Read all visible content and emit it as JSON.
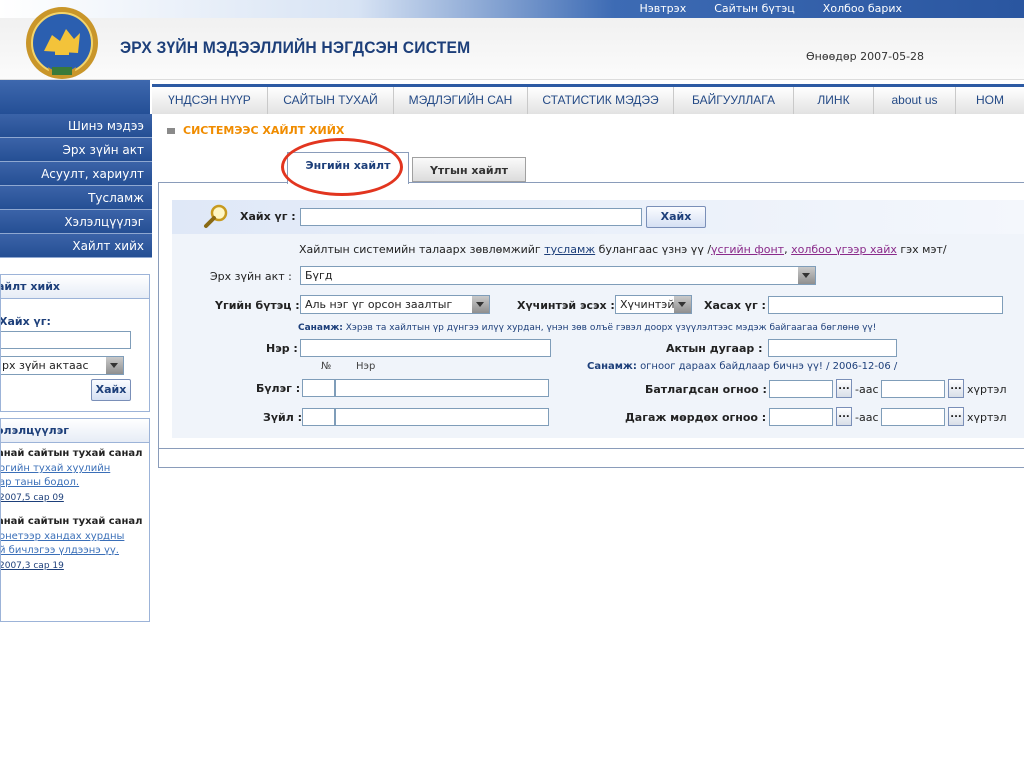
{
  "top_links": [
    "Нэвтрэх",
    "Сайтын бүтэц",
    "Холбоо барих"
  ],
  "site": {
    "title": "ЭРХ ЗҮЙН МЭДЭЭЛЛИЙН НЭГДСЭН СИСТЕМ",
    "today_label": "Өнөөдөр 2007-05-28"
  },
  "main_nav": [
    "ҮНДСЭН НҮҮР",
    "САЙТЫН ТУХАЙ",
    "МЭДЛЭГИЙН САН",
    "СТАТИСТИК МЭДЭЭ",
    "БАЙГУУЛЛАГА",
    "ЛИНК",
    "about us",
    "НОМ"
  ],
  "sidebar": {
    "menu": [
      "Шинэ мэдээ",
      "Эрх зүйн акт",
      "Асуулт, хариулт",
      "Тусламж",
      "Хэлэлцүүлэг",
      "Хайлт хийх"
    ],
    "search_box": {
      "title": "айлт хийх",
      "keyword_label": "Хайх үг:",
      "keyword_value": "",
      "scope_value": "рх зүйн актаас",
      "button": "Хайх"
    },
    "discussion_box": {
      "title": "элэлцүүлэг",
      "items": [
        {
          "title": "анай сайтын тухай санал",
          "link1": "огийн тухай хуулийн",
          "link2": "ар таны бодол.",
          "date": "2007,5 сар 09"
        },
        {
          "title": "анай сайтын тухай санал",
          "link1": "онетээр хандах хурдны",
          "link2": "й бичлэгээ үлдээнэ үү.",
          "date": "2007,3 сар 19"
        }
      ]
    }
  },
  "content": {
    "section_title": "СИСТЕМЭЭС ХАЙЛТ ХИЙХ",
    "tabs": [
      "Энгийн хайлт",
      "Үтгын хайлт"
    ],
    "search": {
      "label": "Хайх үг :",
      "value": "",
      "button": "Хайх"
    },
    "help": {
      "prefix": "Хайлтын системийн талаарх зөвлөмжийг",
      "link1": "тусламж",
      "middle": "булангаас үзнэ үү /",
      "link2": "үсгийн фонт",
      "sep": ",",
      "link3": "холбоо үгээр хайх",
      "suffix": "гэх мэт/"
    },
    "law_label": "Эрх зүйн акт :",
    "law_value": "Бүгд",
    "structure_label": "Үгийн бүтэц :",
    "structure_value": "Аль нэг үг орсон заалтыг",
    "validity_label": "Хүчинтэй эсэх :",
    "validity_value": "Хүчинтэй",
    "exclude_label": "Хасах үг :",
    "exclude_value": "",
    "note1_label": "Санамж:",
    "note1_text": "Хэрэв та хайлтын үр дүнгээ илүү хурдан, үнэн зөв олъё гэвэл доорх үзүүлэлтээс мэдэж байгаагаа бөглөнө үү!",
    "name_label": "Нэр :",
    "name_value": "",
    "act_number_label": "Актын дугаар :",
    "act_number_value": "",
    "col_no": "№",
    "col_name": "Нэр",
    "note2_label": "Санамж:",
    "note2_text": "огноог дараах байдлаар бичнэ үү! / 2006-12-06 /",
    "chapter_label": "Бүлэг :",
    "article_label": "Зүйл :",
    "approved_label": "Батлагдсан огноо :",
    "effective_label": "Дагаж мөрдөх огноо :",
    "from_label": "-аас",
    "to_label": "хүртэл",
    "dots": "..."
  }
}
